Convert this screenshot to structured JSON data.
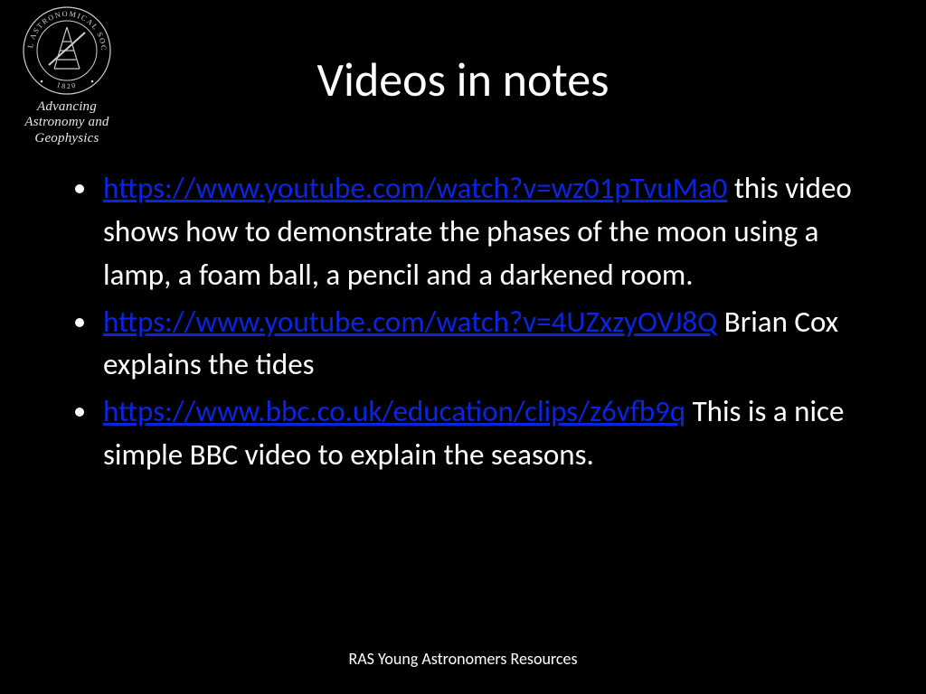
{
  "logo": {
    "top_text": "ROYAL ASTRONOMICAL SOCIETY",
    "year": "1820",
    "tagline": "Advancing Astronomy and Geophysics"
  },
  "title": "Videos in notes",
  "bullets": [
    {
      "link": "https://www.youtube.com/watch?v=wz01pTvuMa0",
      "text": "  this video shows how to demonstrate the phases of the moon using a lamp, a foam ball, a pencil and a darkened room."
    },
    {
      "link": "https://www.youtube.com/watch?v=4UZxzyOVJ8Q",
      "text": "  Brian Cox explains the tides"
    },
    {
      "link": "https://www.bbc.co.uk/education/clips/z6vfb9q",
      "text": "   This is a nice simple BBC video to explain the seasons."
    }
  ],
  "footer": "RAS Young Astronomers Resources"
}
